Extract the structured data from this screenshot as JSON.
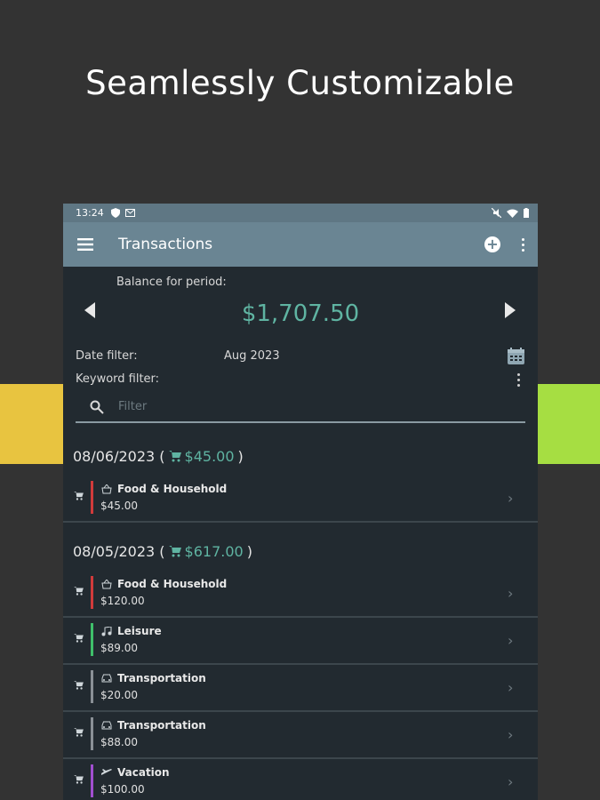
{
  "headline": "Seamlessly Customizable",
  "status_bar": {
    "time": "13:24"
  },
  "app_bar": {
    "title": "Transactions"
  },
  "balance": {
    "label": "Balance for period:",
    "value": "$1,707.50"
  },
  "filters": {
    "date_label": "Date filter:",
    "date_value": "Aug 2023",
    "keyword_label": "Keyword filter:",
    "search_placeholder": "Filter"
  },
  "groups": [
    {
      "date": "08/06/2023 (",
      "total": "$45.00",
      "close": ")",
      "items": [
        {
          "category": "Food & Household",
          "amount": "$45.00",
          "color": "#d13b3b",
          "icon": "basket-icon"
        }
      ]
    },
    {
      "date": "08/05/2023 (",
      "total": "$617.00",
      "close": ")",
      "items": [
        {
          "category": "Food & Household",
          "amount": "$120.00",
          "color": "#d13b3b",
          "icon": "basket-icon"
        },
        {
          "category": "Leisure",
          "amount": "$89.00",
          "color": "#3fbf6a",
          "icon": "music-icon"
        },
        {
          "category": "Transportation",
          "amount": "$20.00",
          "color": "#8a9096",
          "icon": "car-icon"
        },
        {
          "category": "Transportation",
          "amount": "$88.00",
          "color": "#8a9096",
          "icon": "car-icon"
        },
        {
          "category": "Vacation",
          "amount": "$100.00",
          "color": "#a14fd0",
          "icon": "plane-icon"
        }
      ]
    }
  ],
  "colors": {
    "accent": "#5fb4a2",
    "appbar": "#6a8593",
    "background": "#333333",
    "left_band": "#e8c440",
    "right_band": "#a6de42"
  }
}
